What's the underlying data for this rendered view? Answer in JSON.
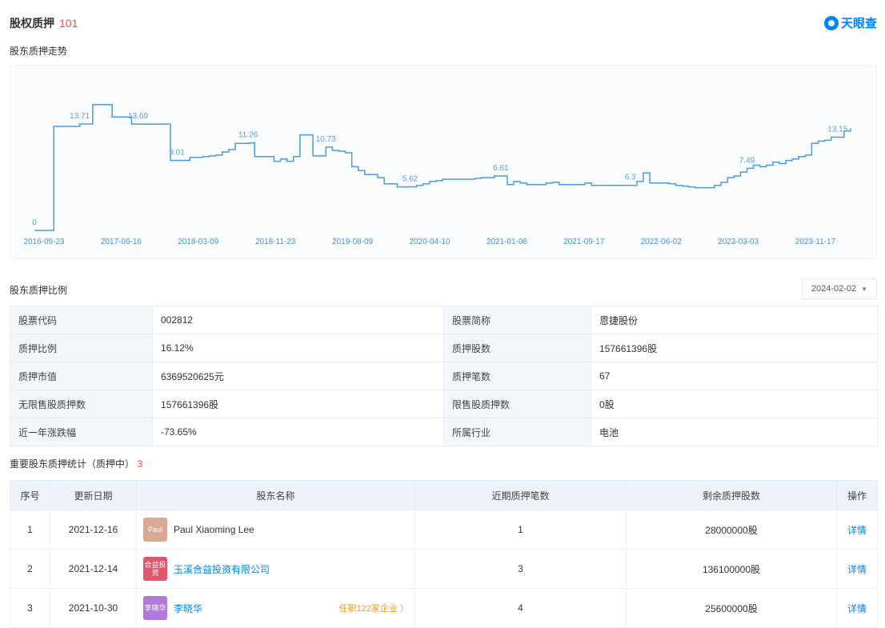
{
  "header": {
    "title": "股权质押",
    "count": "101"
  },
  "brand": {
    "name": "天眼查",
    "color": "#0084ff"
  },
  "trend": {
    "section_title": "股东质押走势",
    "chart_data": {
      "type": "line",
      "title": "",
      "xlabel": "",
      "ylabel": "",
      "x_ticks": [
        "2016-09-23",
        "2017-06-16",
        "2018-03-09",
        "2018-11-23",
        "2019-08-09",
        "2020-04-10",
        "2021-01-08",
        "2021-09-17",
        "2022-06-02",
        "2023-03-03",
        "2023-11-17"
      ],
      "ylim": [
        0,
        17
      ],
      "grid": false,
      "series": [
        {
          "values": [
            0,
            0,
            0,
            13.4,
            13.4,
            13.4,
            13.4,
            13.7,
            13.7,
            16.2,
            16.2,
            16.2,
            14.6,
            14.6,
            14.6,
            13.69,
            13.69,
            13.69,
            13.69,
            13.69,
            13.69,
            9.01,
            9.01,
            9.01,
            9.4,
            9.4,
            9.5,
            9.6,
            9.7,
            10.1,
            10.4,
            11.2,
            11.2,
            11.26,
            9.5,
            9.5,
            9.5,
            8.9,
            9.2,
            8.9,
            9.5,
            12.3,
            12.3,
            9.6,
            9.6,
            10.73,
            10.3,
            10.2,
            10.0,
            8.2,
            7.7,
            7.2,
            7.2,
            6.8,
            6.0,
            6.0,
            5.6,
            5.6,
            5.62,
            5.8,
            6.0,
            6.3,
            6.4,
            6.6,
            6.6,
            6.6,
            6.6,
            6.6,
            6.7,
            6.8,
            6.8,
            7.0,
            7.0,
            5.9,
            6.3,
            6.1,
            5.9,
            5.9,
            5.9,
            6.1,
            6.2,
            5.9,
            5.9,
            5.9,
            5.9,
            6.1,
            5.8,
            5.8,
            5.8,
            5.8,
            5.8,
            5.8,
            5.8,
            6.3,
            7.4,
            6.1,
            6.1,
            6.1,
            6.0,
            5.8,
            5.7,
            5.6,
            5.5,
            5.5,
            5.5,
            5.8,
            6.2,
            6.8,
            7.0,
            7.5,
            8.0,
            8.4,
            8.2,
            8.4,
            8.8,
            8.6,
            9.0,
            9.2,
            9.5,
            9.7,
            11.2,
            11.5,
            11.6,
            12.0,
            12.0,
            12.8,
            13.15
          ],
          "labels": [
            {
              "index": 0,
              "text": "0"
            },
            {
              "index": 7,
              "text": "13.71"
            },
            {
              "index": 16,
              "text": "13.69"
            },
            {
              "index": 22,
              "text": "9.01"
            },
            {
              "index": 33,
              "text": "11.26"
            },
            {
              "index": 45,
              "text": "10.73"
            },
            {
              "index": 58,
              "text": "5.62"
            },
            {
              "index": 72,
              "text": "6.61"
            },
            {
              "index": 92,
              "text": "6.3"
            },
            {
              "index": 110,
              "text": "7.49"
            },
            {
              "index": 124,
              "text": "13.15"
            }
          ]
        }
      ]
    }
  },
  "ratio": {
    "section_title": "股东质押比例",
    "date_value": "2024-02-02",
    "rows": [
      [
        "股票代码",
        "002812",
        "股票简称",
        "恩捷股份"
      ],
      [
        "质押比例",
        "16.12%",
        "质押股数",
        "157661396股"
      ],
      [
        "质押市值",
        "6369520625元",
        "质押笔数",
        "67"
      ],
      [
        "无限售股质押数",
        "157661396股",
        "限售股质押数",
        "0股"
      ],
      [
        "近一年涨跌幅",
        "-73.65%",
        "所属行业",
        "电池"
      ]
    ]
  },
  "holders": {
    "section_title": "重要股东质押统计（质押中）",
    "count": "3",
    "columns": [
      "序号",
      "更新日期",
      "股东名称",
      "近期质押笔数",
      "剩余质押股数",
      "操作"
    ],
    "rows": [
      {
        "idx": "1",
        "date": "2021-12-16",
        "avatar": "Paul",
        "avatar_color": "#d9a993",
        "name": "Paul Xiaoming Lee",
        "tag": "",
        "count": "1",
        "shares": "28000000股",
        "action": "详情"
      },
      {
        "idx": "2",
        "date": "2021-12-14",
        "avatar": "合益投资",
        "avatar_color": "#e0576b",
        "name": "玉溪合益投资有限公司",
        "tag": "",
        "count": "3",
        "shares": "136100000股",
        "action": "详情"
      },
      {
        "idx": "3",
        "date": "2021-10-30",
        "avatar": "李晓华",
        "avatar_color": "#b07ad8",
        "name": "李晓华",
        "tag": "任职122家企业 〉",
        "count": "4",
        "shares": "25600000股",
        "action": "详情"
      }
    ]
  }
}
